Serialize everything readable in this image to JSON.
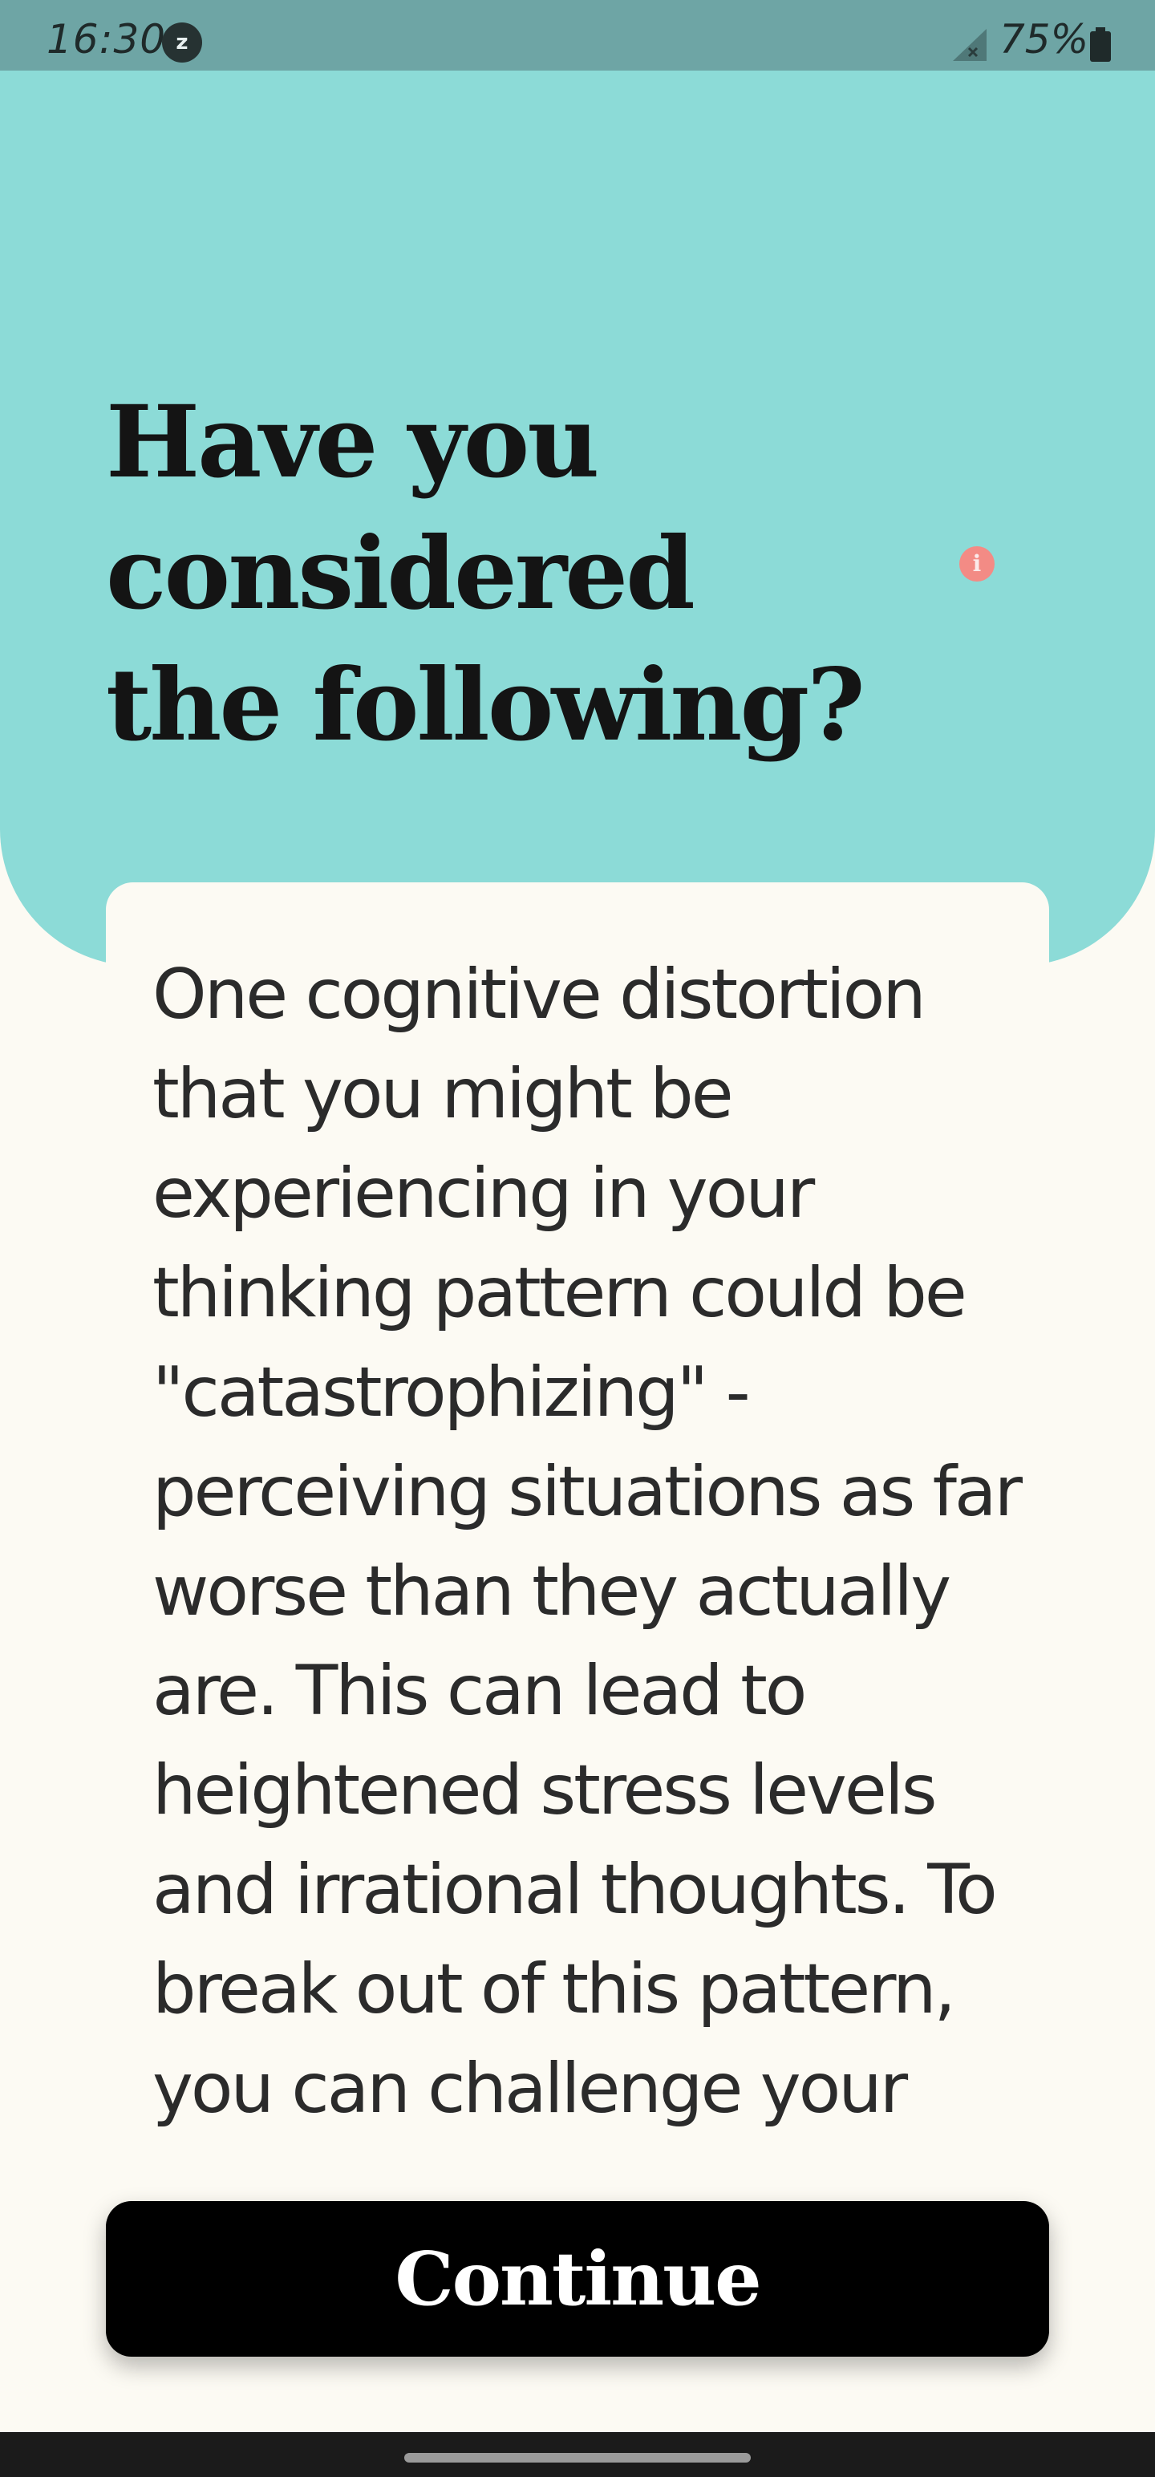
{
  "status_bar": {
    "time": "16:30",
    "notification_badge": "z",
    "battery_percent": "75%",
    "icons": [
      "signal-icon",
      "battery-icon"
    ]
  },
  "header": {
    "title": "Have you considered the following?",
    "info_icon": "info-icon",
    "info_glyph": "i"
  },
  "content": {
    "body": "One cognitive distortion that you might be experiencing in your thinking pattern could be \"catastrophizing\" - perceiving situations as far worse than they actually are. This can lead to heightened stress levels and irrational thoughts. To break out of this pattern, you can challenge your"
  },
  "footer": {
    "continue_label": "Continue"
  },
  "colors": {
    "header_teal": "#8cdbd7",
    "status_bar": "#6ea5a5",
    "background": "#fcfaf3",
    "info_accent": "#f38b85",
    "button": "#000000"
  }
}
